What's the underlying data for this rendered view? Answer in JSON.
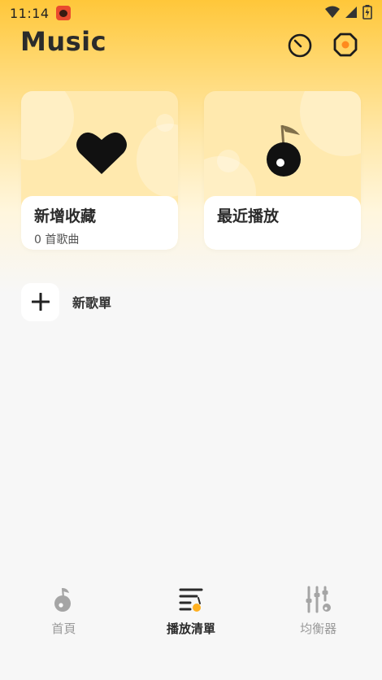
{
  "status_bar": {
    "time": "11:14"
  },
  "header": {
    "title": "Music",
    "timer_icon": "timer-icon",
    "settings_icon": "settings-icon"
  },
  "cards": [
    {
      "title": "新增收藏",
      "subtitle": "0 首歌曲",
      "icon": "heart-icon"
    },
    {
      "title": "最近播放",
      "subtitle": "",
      "icon": "music-note-icon"
    }
  ],
  "new_playlist": {
    "label": "新歌單"
  },
  "bottom_nav": {
    "items": [
      {
        "label": "首頁",
        "icon": "home-icon",
        "active": false
      },
      {
        "label": "播放清單",
        "icon": "playlist-icon",
        "active": true
      },
      {
        "label": "均衡器",
        "icon": "equalizer-icon",
        "active": false
      }
    ]
  },
  "colors": {
    "accent": "#FFC73A",
    "active_nav_dot": "#FFB020",
    "background": "#F7F7F7"
  }
}
